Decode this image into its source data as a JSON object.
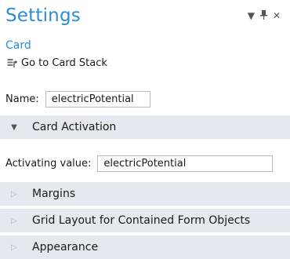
{
  "header": {
    "title": "Settings",
    "controls": [
      {
        "name": "dropdown-icon",
        "glyph": "▾"
      },
      {
        "name": "pin-icon",
        "glyph": "⊥"
      },
      {
        "name": "close-icon",
        "glyph": "✕"
      }
    ]
  },
  "node": {
    "subtitle": "Card",
    "go_to_label": "Go to Card Stack",
    "go_to_icon": "card-stack-icon"
  },
  "name_field": {
    "label": "Name:",
    "value": "electricPotential"
  },
  "sections": [
    {
      "label": "Card Activation",
      "expanded": true
    },
    {
      "label": "Margins",
      "expanded": false
    },
    {
      "label": "Grid Layout for Contained Form Objects",
      "expanded": false
    },
    {
      "label": "Appearance",
      "expanded": false
    }
  ],
  "activation": {
    "label": "Activating value:",
    "value": "electricPotential"
  },
  "colors": {
    "accent": "#2a8dd4",
    "section_bg": "#e4e9f0"
  }
}
